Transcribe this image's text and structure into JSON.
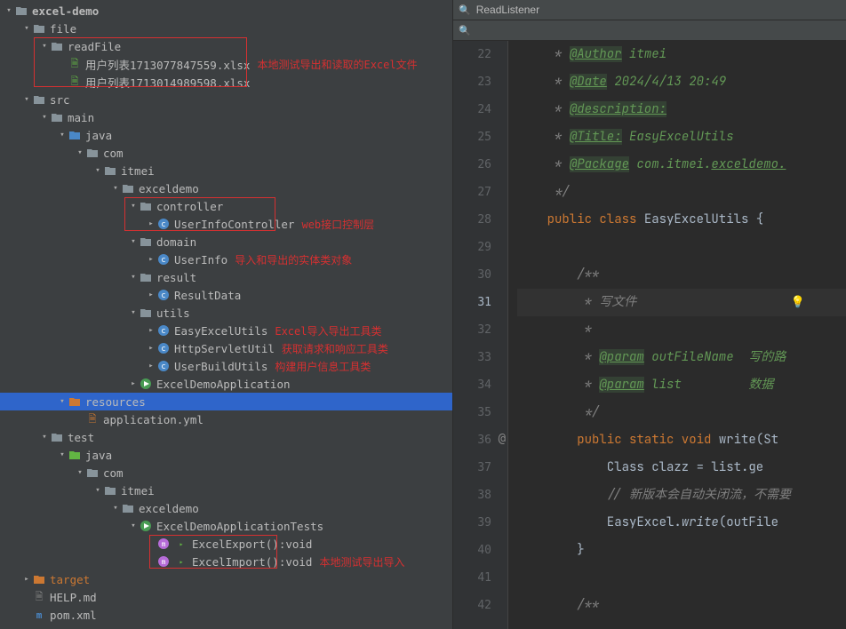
{
  "search": {
    "placeholder_icon": "🔍",
    "value": "ReadListener"
  },
  "tree": {
    "root": "excel-demo",
    "file": "file",
    "readFile": "readFile",
    "xlsx1": "用户列表1713077847559.xlsx",
    "xlsx2": "用户列表1713014989598.xlsx",
    "ann_readFile": "本地测试导出和读取的Excel文件",
    "src": "src",
    "main": "main",
    "java": "java",
    "com": "com",
    "itmei": "itmei",
    "exceldemo": "exceldemo",
    "controller": "controller",
    "userInfoController": "UserInfoController",
    "ann_controller": "web接口控制层",
    "domain": "domain",
    "userInfo": "UserInfo",
    "ann_domain": "导入和导出的实体类对象",
    "result": "result",
    "resultData": "ResultData",
    "utils": "utils",
    "easyExcelUtils": "EasyExcelUtils",
    "ann_utils1": "Excel导入导出工具类",
    "httpServletUtil": "HttpServletUtil",
    "ann_utils2": "获取请求和响应工具类",
    "userBuildUtils": "UserBuildUtils",
    "ann_utils3": "构建用户信息工具类",
    "excelDemoApp": "ExcelDemoApplication",
    "resources": "resources",
    "appYml": "application.yml",
    "test": "test",
    "tests": "ExcelDemoApplicationTests",
    "export": "ExcelExport():void",
    "import": "ExcelImport():void",
    "ann_test": "本地测试导出导入",
    "target": "target",
    "help": "HELP.md",
    "pom": "pom.xml"
  },
  "code": {
    "line_start": 22,
    "lines": {
      "22": {
        "pre": "     * ",
        "tag": "@Author",
        "val": " itmei"
      },
      "23": {
        "pre": "     * ",
        "tag": "@Date",
        "val": " 2024/4/13 20:49"
      },
      "24": {
        "pre": "     * ",
        "tag": "@description:",
        "val": ""
      },
      "25": {
        "pre": "     * ",
        "tag": "@Title:",
        "val": " EasyExcelUtils"
      },
      "26": {
        "pre": "     * ",
        "tag": "@Package",
        "val": " com.itmei.",
        "ident": "exceldemo."
      },
      "27": {
        "text": "     */"
      },
      "28": {
        "kw": "    public class ",
        "name": "EasyExcelUtils {"
      },
      "29": {
        "text": ""
      },
      "30": {
        "text": "        /**"
      },
      "31": {
        "text": "         * 写文件"
      },
      "32": {
        "text": "         *"
      },
      "33": {
        "pre": "         * ",
        "tag": "@param",
        "val": " outFileName  写的路"
      },
      "34": {
        "pre": "         * ",
        "tag": "@param",
        "val": " list         数据"
      },
      "35": {
        "text": "         */"
      },
      "36": {
        "kw": "        public static void ",
        "name": "write(St"
      },
      "37": {
        "text": "            Class<?> clazz = list.ge"
      },
      "38": {
        "text": "            // 新版本会自动关闭流，不需要"
      },
      "39": {
        "text": "            EasyExcel.",
        "ident": "write",
        "tail": "(outFile"
      },
      "40": {
        "text": "        }"
      },
      "41": {
        "text": ""
      },
      "42": {
        "text": "        /**"
      }
    },
    "current_line": 31
  }
}
